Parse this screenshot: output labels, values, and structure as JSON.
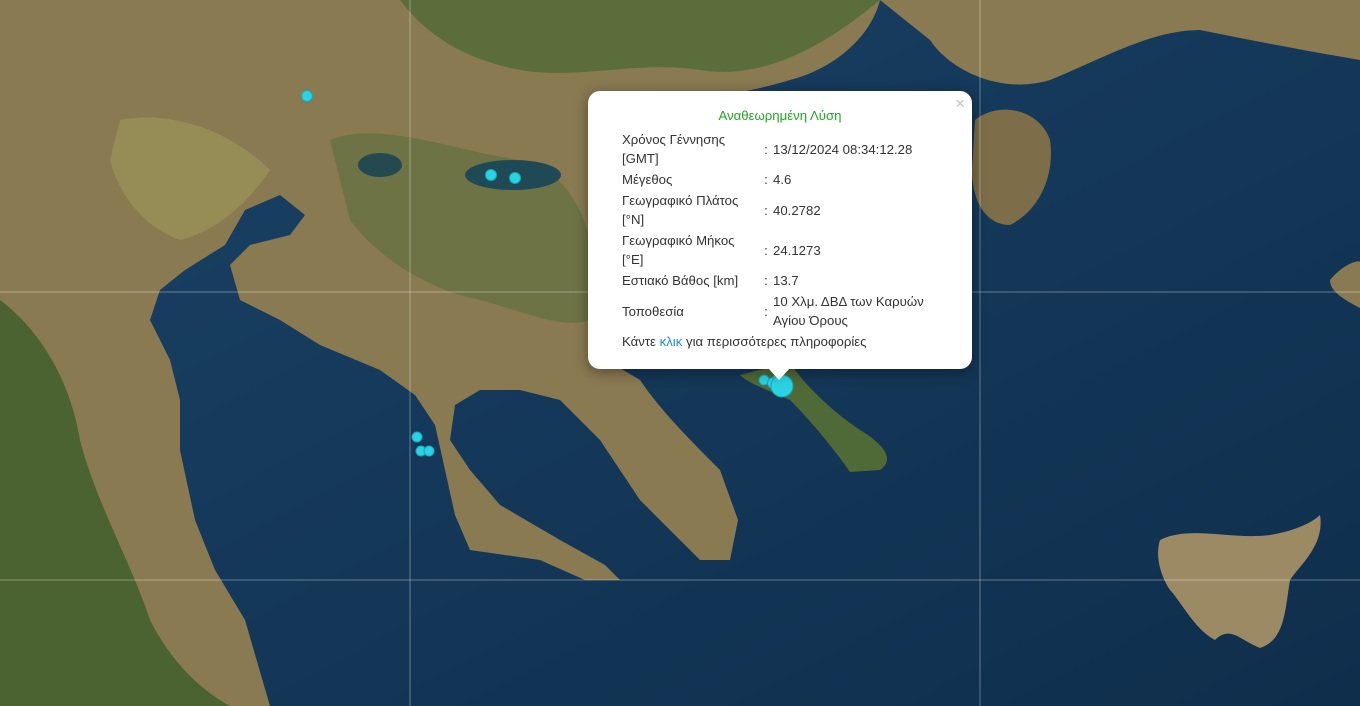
{
  "popup": {
    "title": "Αναθεωρημένη Λύση",
    "close_glyph": "×",
    "rows": [
      {
        "label": "Χρόνος Γέννησης [GMT]",
        "value": "13/12/2024 08:34:12.28"
      },
      {
        "label": "Μέγεθος",
        "value": "4.6"
      },
      {
        "label": "Γεωγραφικό Πλάτος [°N]",
        "value": "40.2782"
      },
      {
        "label": "Γεωγραφικό Μήκος [°E]",
        "value": "24.1273"
      },
      {
        "label": "Εστιακό Βάθος [km]",
        "value": "13.7"
      },
      {
        "label": "Τοποθεσία",
        "value": "10 Χλμ. ΔΒΔ των Καρυών Αγίου Όρους"
      }
    ],
    "separator": ":",
    "more_prefix": "Κάντε ",
    "more_link": "κλικ",
    "more_suffix": " για περισσότερες πληροφορίες"
  },
  "colors": {
    "sea": "#14385a",
    "land": "#8a7a52",
    "land_green": "#3f5e2c",
    "marker": "#29d3e3",
    "popup_title": "#1ea81e",
    "link": "#1a8fd6"
  },
  "markers": [
    {
      "name": "marker-lake-north"
    },
    {
      "name": "marker-volvi-west"
    },
    {
      "name": "marker-volvi-east"
    },
    {
      "name": "marker-gulf-1"
    },
    {
      "name": "marker-gulf-2"
    },
    {
      "name": "marker-gulf-3"
    },
    {
      "name": "marker-athos-1"
    },
    {
      "name": "marker-athos-2"
    },
    {
      "name": "marker-athos-3"
    },
    {
      "name": "marker-athos-main"
    }
  ]
}
